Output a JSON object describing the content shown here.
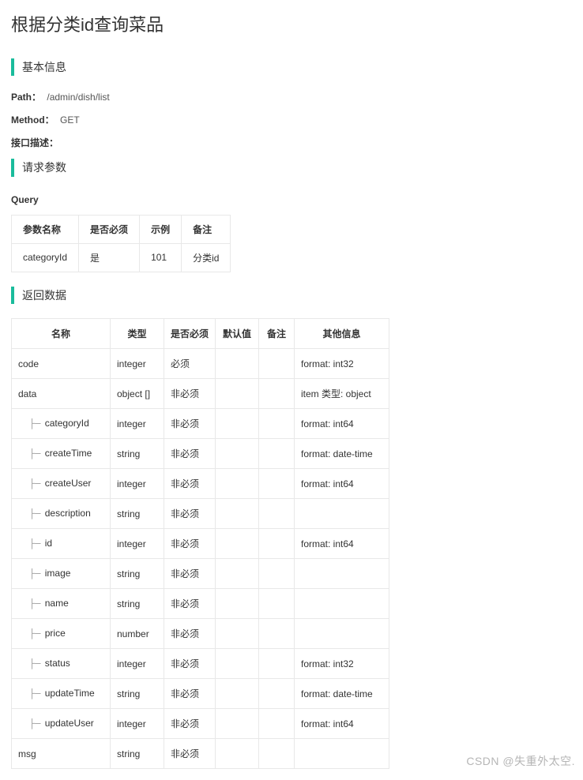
{
  "title": "根据分类id查询菜品",
  "sections": {
    "basic": "基本信息",
    "req": "请求参数",
    "resp": "返回数据"
  },
  "info": {
    "path_label": "Path：",
    "path_value": "/admin/dish/list",
    "method_label": "Method：",
    "method_value": "GET",
    "desc_label": "接口描述："
  },
  "query": {
    "header": "Query",
    "th": {
      "name": "参数名称",
      "required": "是否必须",
      "example": "示例",
      "note": "备注"
    },
    "rows": [
      {
        "name": "categoryId",
        "required": "是",
        "example": "101",
        "note": "分类id"
      }
    ]
  },
  "resp": {
    "th": {
      "name": "名称",
      "type": "类型",
      "required": "是否必须",
      "default": "默认值",
      "note": "备注",
      "other": "其他信息"
    },
    "rows": [
      {
        "indent": 0,
        "name": "code",
        "type": "integer",
        "required": "必须",
        "default": "",
        "note": "",
        "other": "format: int32"
      },
      {
        "indent": 0,
        "name": "data",
        "type": "object []",
        "required": "非必须",
        "default": "",
        "note": "",
        "other": "item 类型: object"
      },
      {
        "indent": 1,
        "name": "categoryId",
        "type": "integer",
        "required": "非必须",
        "default": "",
        "note": "",
        "other": "format: int64"
      },
      {
        "indent": 1,
        "name": "createTime",
        "type": "string",
        "required": "非必须",
        "default": "",
        "note": "",
        "other": "format: date-time"
      },
      {
        "indent": 1,
        "name": "createUser",
        "type": "integer",
        "required": "非必须",
        "default": "",
        "note": "",
        "other": "format: int64"
      },
      {
        "indent": 1,
        "name": "description",
        "type": "string",
        "required": "非必须",
        "default": "",
        "note": "",
        "other": ""
      },
      {
        "indent": 1,
        "name": "id",
        "type": "integer",
        "required": "非必须",
        "default": "",
        "note": "",
        "other": "format: int64"
      },
      {
        "indent": 1,
        "name": "image",
        "type": "string",
        "required": "非必须",
        "default": "",
        "note": "",
        "other": ""
      },
      {
        "indent": 1,
        "name": "name",
        "type": "string",
        "required": "非必须",
        "default": "",
        "note": "",
        "other": ""
      },
      {
        "indent": 1,
        "name": "price",
        "type": "number",
        "required": "非必须",
        "default": "",
        "note": "",
        "other": ""
      },
      {
        "indent": 1,
        "name": "status",
        "type": "integer",
        "required": "非必须",
        "default": "",
        "note": "",
        "other": "format: int32"
      },
      {
        "indent": 1,
        "name": "updateTime",
        "type": "string",
        "required": "非必须",
        "default": "",
        "note": "",
        "other": "format: date-time"
      },
      {
        "indent": 1,
        "name": "updateUser",
        "type": "integer",
        "required": "非必须",
        "default": "",
        "note": "",
        "other": "format: int64"
      },
      {
        "indent": 0,
        "name": "msg",
        "type": "string",
        "required": "非必须",
        "default": "",
        "note": "",
        "other": ""
      }
    ]
  },
  "watermark": "CSDN @失重外太空."
}
